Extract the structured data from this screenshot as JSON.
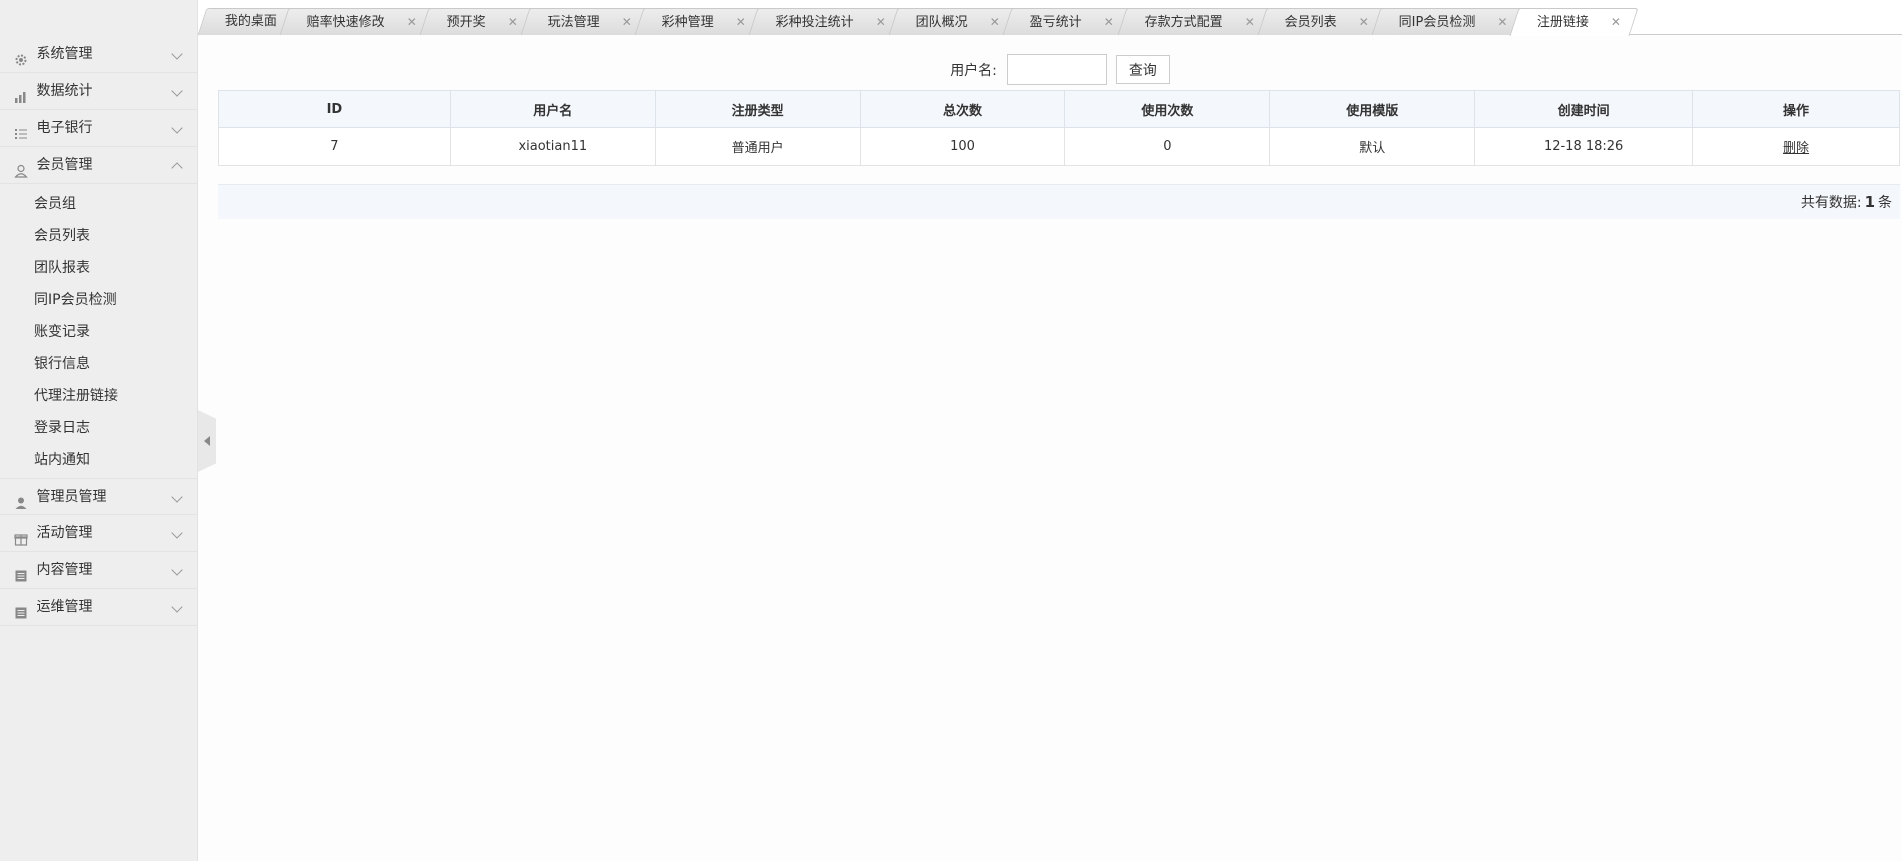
{
  "sidebar": {
    "menus": [
      {
        "label": "系统管理",
        "icon": "gear-icon",
        "expanded": false
      },
      {
        "label": "数据统计",
        "icon": "bar-chart-icon",
        "expanded": false
      },
      {
        "label": "电子银行",
        "icon": "list-icon",
        "expanded": false
      },
      {
        "label": "会员管理",
        "icon": "user-icon",
        "expanded": true
      },
      {
        "label": "管理员管理",
        "icon": "admin-icon",
        "expanded": false
      },
      {
        "label": "活动管理",
        "icon": "gift-icon",
        "expanded": false
      },
      {
        "label": "内容管理",
        "icon": "document-icon",
        "expanded": false
      },
      {
        "label": "运维管理",
        "icon": "document-icon",
        "expanded": false
      }
    ],
    "member_submenu": [
      "会员组",
      "会员列表",
      "团队报表",
      "同IP会员检测",
      "账变记录",
      "银行信息",
      "代理注册链接",
      "登录日志",
      "站内通知"
    ]
  },
  "tabs": [
    {
      "label": "我的桌面",
      "closable": false
    },
    {
      "label": "赔率快速修改",
      "closable": true
    },
    {
      "label": "预开奖",
      "closable": true
    },
    {
      "label": "玩法管理",
      "closable": true
    },
    {
      "label": "彩种管理",
      "closable": true
    },
    {
      "label": "彩种投注统计",
      "closable": true
    },
    {
      "label": "团队概况",
      "closable": true
    },
    {
      "label": "盈亏统计",
      "closable": true
    },
    {
      "label": "存款方式配置",
      "closable": true
    },
    {
      "label": "会员列表",
      "closable": true
    },
    {
      "label": "同IP会员检测",
      "closable": true
    },
    {
      "label": "注册链接",
      "closable": true,
      "active": true
    }
  ],
  "search": {
    "label": "用户名:",
    "value": "",
    "button": "查询"
  },
  "table": {
    "headers": [
      "ID",
      "用户名",
      "注册类型",
      "总次数",
      "使用次数",
      "使用模版",
      "创建时间",
      "操作"
    ],
    "rows": [
      [
        "7",
        "xiaotian11",
        "普通用户",
        "100",
        "0",
        "默认",
        "12-18 18:26",
        "删除"
      ]
    ]
  },
  "footer": {
    "prefix": "共有数据:",
    "count": "1",
    "suffix": "条"
  }
}
